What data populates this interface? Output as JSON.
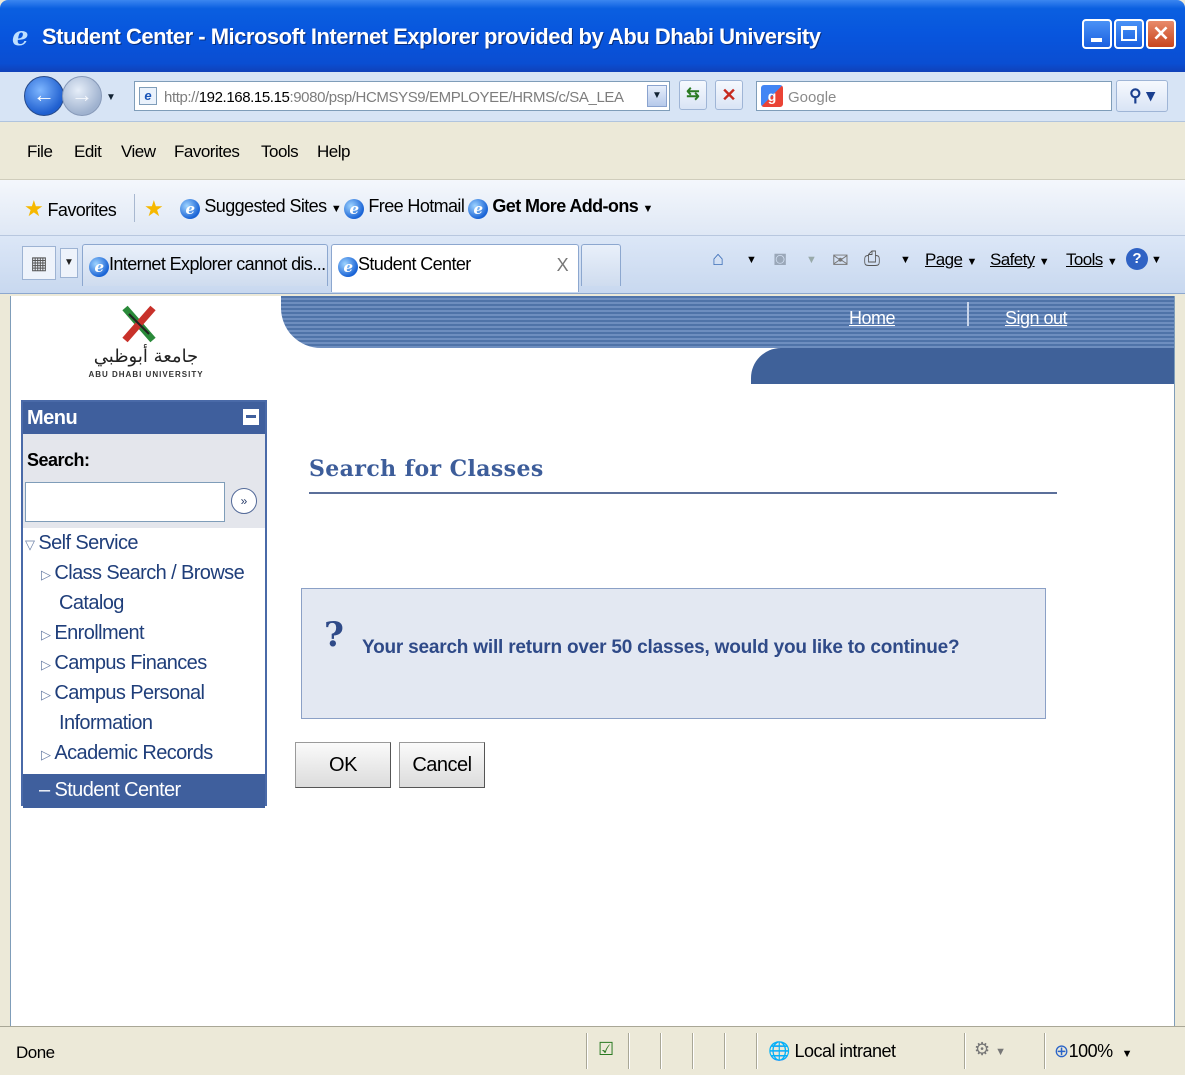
{
  "window": {
    "title": "Student Center - Microsoft Internet Explorer provided by Abu Dhabi University"
  },
  "address_bar": {
    "url_scheme": "http://",
    "url_host": "192.168.15.15",
    "url_rest": ":9080/psp/HCMSYS9/EMPLOYEE/HRMS/c/SA_LEA",
    "search_placeholder": "Google"
  },
  "menu_bar": [
    "File",
    "Edit",
    "View",
    "Favorites",
    "Tools",
    "Help"
  ],
  "favorites_bar": {
    "favorites_label": "Favorites",
    "suggested_sites": "Suggested Sites",
    "free_hotmail": "Free Hotmail",
    "get_addons": "Get More Add-ons"
  },
  "tabs": [
    {
      "label": "Internet Explorer cannot dis...",
      "active": false
    },
    {
      "label": "Student Center",
      "active": true
    }
  ],
  "command_bar": {
    "page": "Page",
    "safety": "Safety",
    "tools": "Tools"
  },
  "site": {
    "logo_arabic": "جامعة أبوظبي",
    "logo_english": "ABU DHABI UNIVERSITY",
    "nav": {
      "home": "Home",
      "sign_out": "Sign out"
    }
  },
  "menu": {
    "header": "Menu",
    "search_label": "Search:",
    "search_value": "",
    "items": [
      {
        "label": "Self Service",
        "level": 0,
        "expanded": true
      },
      {
        "label": "Class Search / Browse",
        "level": 1
      },
      {
        "label": "Catalog",
        "level": 1,
        "continuation": true
      },
      {
        "label": "Enrollment",
        "level": 1
      },
      {
        "label": "Campus Finances",
        "level": 1
      },
      {
        "label": "Campus Personal",
        "level": 1
      },
      {
        "label": "Information",
        "level": 1,
        "continuation": true
      },
      {
        "label": "Academic Records",
        "level": 1
      },
      {
        "label": "Student Center",
        "level": 1,
        "selected": true
      }
    ]
  },
  "main": {
    "page_title": "Search for Classes",
    "message": "Your search will return over 50 classes, would you like to continue?",
    "ok_label": "OK",
    "cancel_label": "Cancel"
  },
  "status_bar": {
    "status": "Done",
    "zone": "Local intranet",
    "zoom": "100%"
  },
  "colors": {
    "xp_title_blue": "#0855dd",
    "psft_nav_blue": "#3f5f9d",
    "message_text": "#2f4a88",
    "message_bg": "#e3e8f2"
  }
}
